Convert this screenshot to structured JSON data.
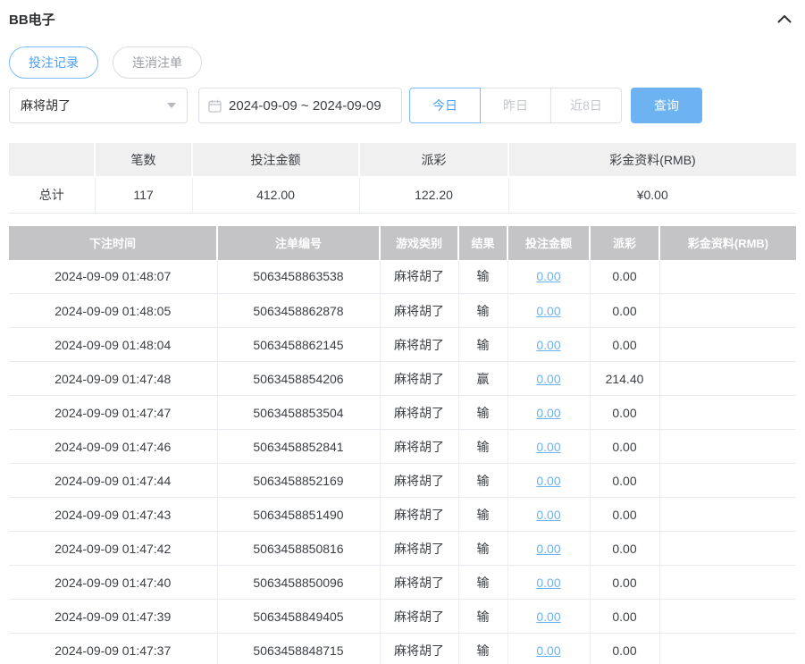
{
  "panel": {
    "title": "BB电子"
  },
  "tabs": [
    {
      "label": "投注记录",
      "active": true
    },
    {
      "label": "连消注单",
      "active": false
    }
  ],
  "filters": {
    "game_select": {
      "value": "麻将胡了"
    },
    "date_range": {
      "value": "2024-09-09 ~ 2024-09-09"
    },
    "quick_ranges": [
      {
        "label": "今日",
        "active": true
      },
      {
        "label": "昨日",
        "active": false
      },
      {
        "label": "近8日",
        "active": false
      }
    ],
    "query_label": "查询"
  },
  "summary": {
    "headers": [
      "",
      "笔数",
      "投注金额",
      "派彩",
      "彩金资料(RMB)"
    ],
    "row": {
      "label": "总计",
      "count": "117",
      "bet_amount": "412.00",
      "payout": "122.20",
      "jackpot": "¥0.00"
    }
  },
  "records": {
    "headers": [
      "下注时间",
      "注单编号",
      "游戏类别",
      "结果",
      "投注金额",
      "派彩",
      "彩金资料(RMB)"
    ],
    "rows": [
      {
        "time": "2024-09-09 01:48:07",
        "order_no": "5063458863538",
        "game": "麻将胡了",
        "result": "输",
        "bet": "0.00",
        "payout": "0.00",
        "jackpot": ""
      },
      {
        "time": "2024-09-09 01:48:05",
        "order_no": "5063458862878",
        "game": "麻将胡了",
        "result": "输",
        "bet": "0.00",
        "payout": "0.00",
        "jackpot": ""
      },
      {
        "time": "2024-09-09 01:48:04",
        "order_no": "5063458862145",
        "game": "麻将胡了",
        "result": "输",
        "bet": "0.00",
        "payout": "0.00",
        "jackpot": ""
      },
      {
        "time": "2024-09-09 01:47:48",
        "order_no": "5063458854206",
        "game": "麻将胡了",
        "result": "赢",
        "bet": "0.00",
        "payout": "214.40",
        "jackpot": ""
      },
      {
        "time": "2024-09-09 01:47:47",
        "order_no": "5063458853504",
        "game": "麻将胡了",
        "result": "输",
        "bet": "0.00",
        "payout": "0.00",
        "jackpot": ""
      },
      {
        "time": "2024-09-09 01:47:46",
        "order_no": "5063458852841",
        "game": "麻将胡了",
        "result": "输",
        "bet": "0.00",
        "payout": "0.00",
        "jackpot": ""
      },
      {
        "time": "2024-09-09 01:47:44",
        "order_no": "5063458852169",
        "game": "麻将胡了",
        "result": "输",
        "bet": "0.00",
        "payout": "0.00",
        "jackpot": ""
      },
      {
        "time": "2024-09-09 01:47:43",
        "order_no": "5063458851490",
        "game": "麻将胡了",
        "result": "输",
        "bet": "0.00",
        "payout": "0.00",
        "jackpot": ""
      },
      {
        "time": "2024-09-09 01:47:42",
        "order_no": "5063458850816",
        "game": "麻将胡了",
        "result": "输",
        "bet": "0.00",
        "payout": "0.00",
        "jackpot": ""
      },
      {
        "time": "2024-09-09 01:47:40",
        "order_no": "5063458850096",
        "game": "麻将胡了",
        "result": "输",
        "bet": "0.00",
        "payout": "0.00",
        "jackpot": ""
      },
      {
        "time": "2024-09-09 01:47:39",
        "order_no": "5063458849405",
        "game": "麻将胡了",
        "result": "输",
        "bet": "0.00",
        "payout": "0.00",
        "jackpot": ""
      },
      {
        "time": "2024-09-09 01:47:37",
        "order_no": "5063458848715",
        "game": "麻将胡了",
        "result": "输",
        "bet": "0.00",
        "payout": "0.00",
        "jackpot": ""
      }
    ]
  },
  "colors": {
    "accent_blue": "#6db3f2",
    "link_blue": "#6db3f2",
    "table_header_gray": "#c4c4c6",
    "summary_header_gray": "#f0f0f0",
    "text_dark": "#303133",
    "muted_gray": "#c3c7ce"
  }
}
